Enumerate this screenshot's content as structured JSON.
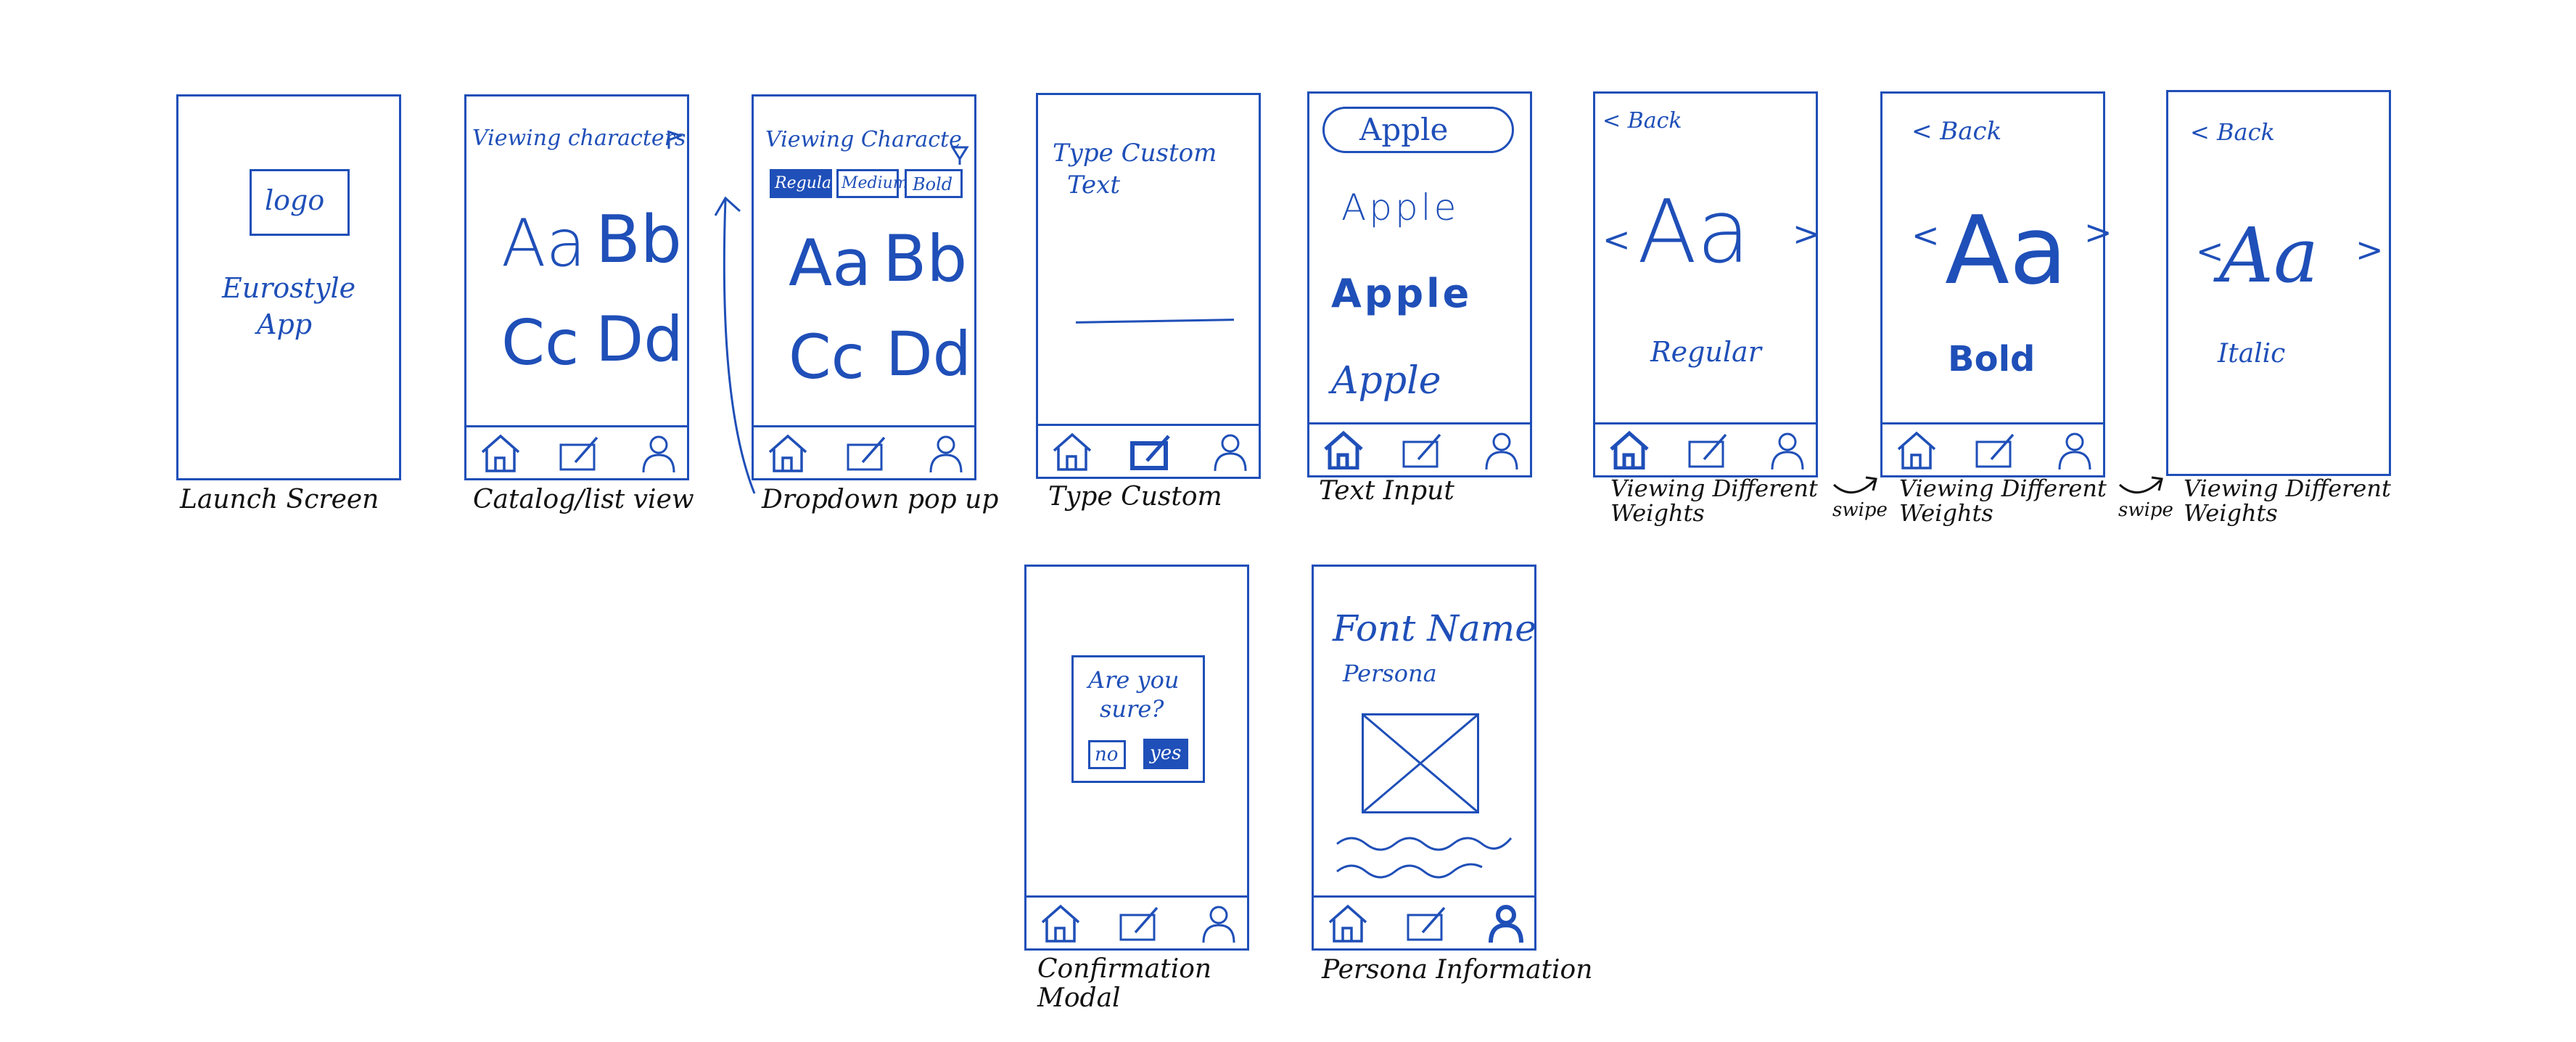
{
  "captions": {
    "launch": "Launch Screen",
    "catalog": "Catalog/list view",
    "dropdown": "Dropdown pop up",
    "type_custom": "Type Custom",
    "text_input": "Text Input",
    "weights1": "Viewing Different Weights",
    "weights2": "Viewing Different Weights",
    "weights3": "Viewing Different Weights",
    "confirm": "Confirmation Modal",
    "persona": "Persona Information"
  },
  "launch": {
    "logo": "logo",
    "app_name_1": "Eurostyle",
    "app_name_2": "App"
  },
  "catalog": {
    "header": "Viewing characters",
    "aa": "Aa",
    "bb": "Bb",
    "cc": "Cc",
    "dd": "Dd"
  },
  "dropdown": {
    "header": "Viewing Characte",
    "opt_regular": "Regular",
    "opt_medium": "Medium",
    "opt_bold": "Bold",
    "aa": "Aa",
    "bb": "Bb",
    "cc": "Cc",
    "dd": "Dd"
  },
  "type_custom": {
    "line1": "Type Custom",
    "line2": "Text"
  },
  "text_input": {
    "field": "Apple",
    "light": "Apple",
    "bold": "Apple",
    "italic": "Apple"
  },
  "weights1": {
    "back": "< Back",
    "sample": "Aa",
    "label": "Regular",
    "prev": "<",
    "next": ">"
  },
  "weights2": {
    "back": "< Back",
    "sample": "Aa",
    "label": "Bold",
    "prev": "<",
    "next": ">"
  },
  "weights3": {
    "back": "< Back",
    "sample": "Aa",
    "label": "Italic",
    "prev": "<",
    "next": ">"
  },
  "swipes": {
    "s1": "swipe",
    "s2": "swipe"
  },
  "confirm": {
    "q1": "Are you",
    "q2": "sure?",
    "no": "no",
    "yes": "yes"
  },
  "persona": {
    "font_name": "Font Name",
    "label": "Persona"
  },
  "colors": {
    "ink": "#1f4fb8",
    "caption": "#111111"
  }
}
